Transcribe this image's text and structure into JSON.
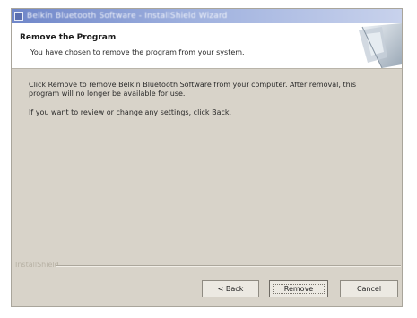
{
  "window": {
    "title": "Belkin Bluetooth Software - InstallShield Wizard"
  },
  "header": {
    "title": "Remove the Program",
    "subtitle": "You have chosen to remove the program from your system."
  },
  "body": {
    "paragraph1": "Click Remove to remove Belkin Bluetooth Software from your computer. After removal, this program will no longer be available for use.",
    "paragraph2": "If you want to review or change any settings, click Back."
  },
  "footer": {
    "brand": "InstallShield"
  },
  "buttons": {
    "back": "< Back",
    "remove": "Remove",
    "cancel": "Cancel"
  },
  "icons": {
    "app": "installer-app-icon",
    "header_graphic": "computer-graphic-icon"
  }
}
